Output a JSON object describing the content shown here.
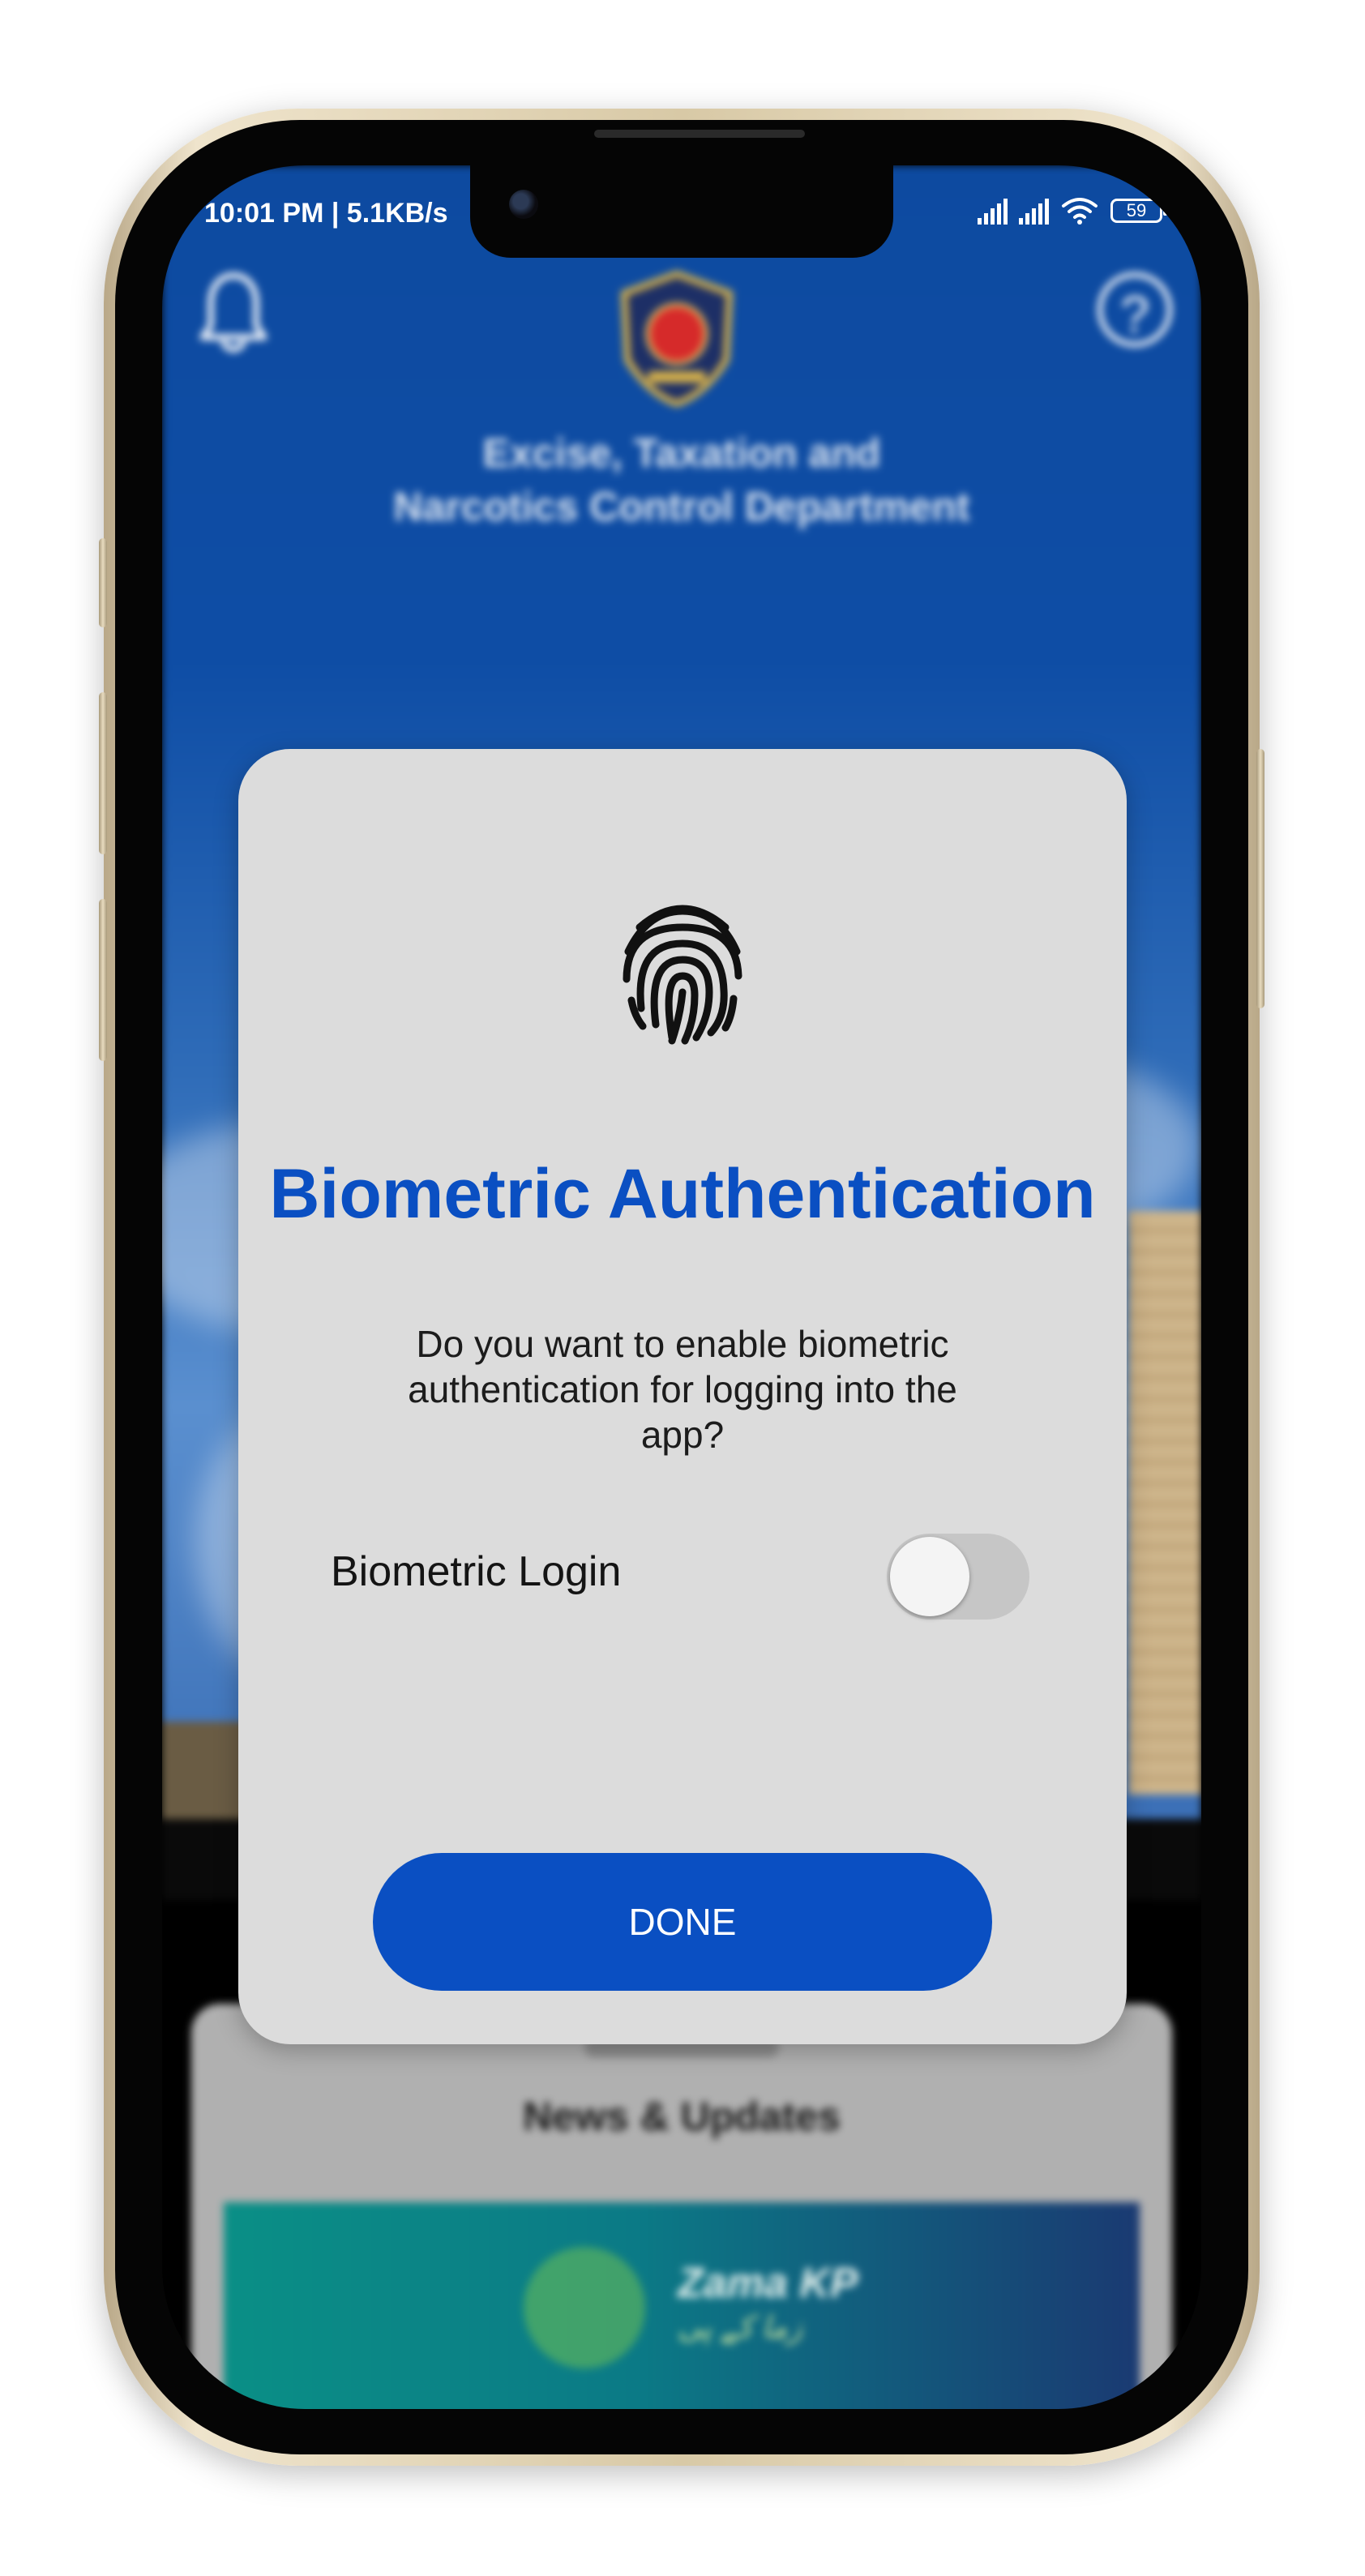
{
  "status_bar": {
    "time": "10:01 PM | 5.1KB/s",
    "battery": "59"
  },
  "header": {
    "title": "Excise, Taxation and Narcotics Control Department"
  },
  "dialog": {
    "title": "Biometric Authentication",
    "message": "Do you want to enable biometric authentication for logging into the app?",
    "toggle_label": "Biometric Login",
    "toggle_on": false,
    "done_label": "DONE"
  },
  "news": {
    "title": "News & Updates",
    "banner_title": "Zama KP",
    "banner_subtitle": "زما کے پی"
  },
  "colors": {
    "accent": "#0a4fc2",
    "dialog_bg": "#dcdcdc",
    "header_bg": "#0d4aa0"
  },
  "icons": [
    "bell-icon",
    "help-icon",
    "department-logo",
    "fingerprint-icon",
    "signal-icon",
    "wifi-icon",
    "battery-icon"
  ]
}
